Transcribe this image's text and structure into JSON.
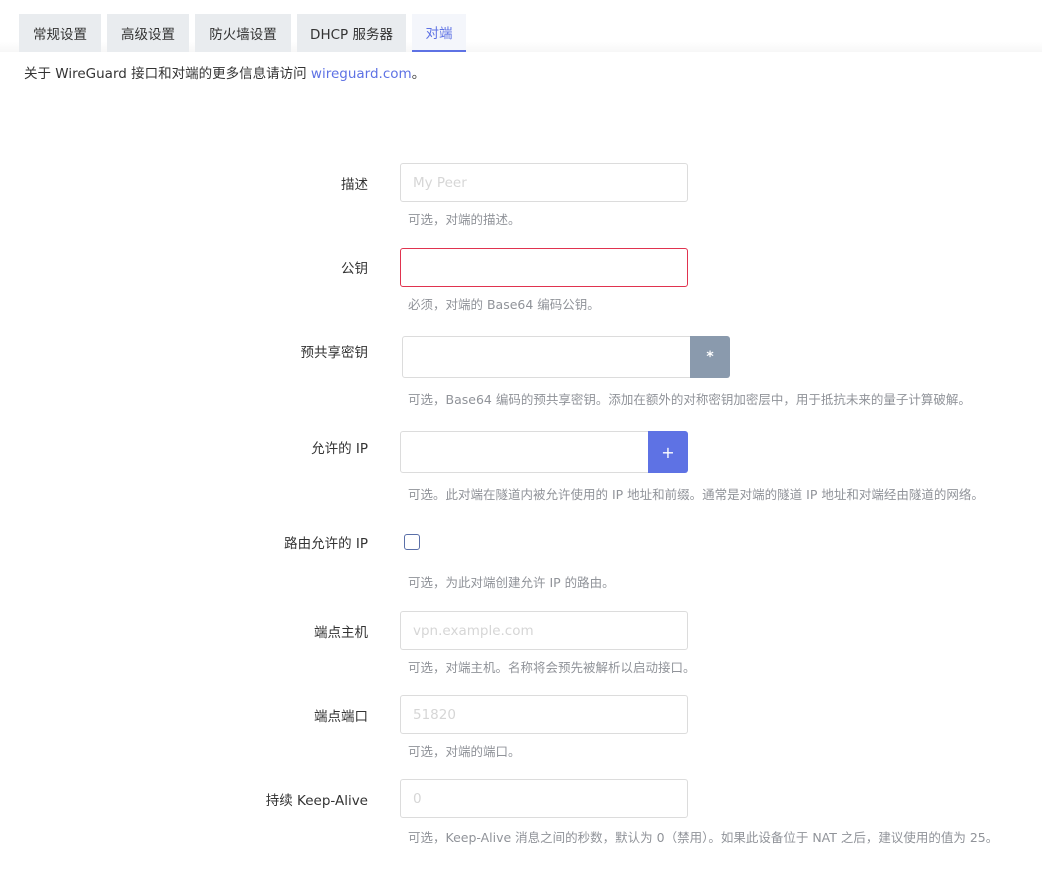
{
  "tabs": [
    {
      "label": "常规设置"
    },
    {
      "label": "高级设置"
    },
    {
      "label": "防火墙设置"
    },
    {
      "label": "DHCP 服务器"
    },
    {
      "label": "对端"
    }
  ],
  "info": {
    "prefix": "关于 WireGuard 接口和对端的更多信息请访问 ",
    "link_text": "wireguard.com",
    "suffix": "。"
  },
  "form": {
    "description": {
      "label": "描述",
      "placeholder": "My Peer",
      "value": "",
      "hint": "可选，对端的描述。"
    },
    "public_key": {
      "label": "公钥",
      "value": "",
      "hint": "必须，对端的 Base64 编码公钥。"
    },
    "preshared_key": {
      "label": "预共享密钥",
      "value": "",
      "button": "*",
      "hint": "可选，Base64 编码的预共享密钥。添加在额外的对称密钥加密层中，用于抵抗未来的量子计算破解。"
    },
    "allowed_ips": {
      "label": "允许的 IP",
      "value": "",
      "button": "+",
      "hint": "可选。此对端在隧道内被允许使用的 IP 地址和前缀。通常是对端的隧道 IP 地址和对端经由隧道的网络。"
    },
    "route_allowed_ips": {
      "label": "路由允许的 IP",
      "checked": false,
      "hint": "可选，为此对端创建允许 IP 的路由。"
    },
    "endpoint_host": {
      "label": "端点主机",
      "placeholder": "vpn.example.com",
      "value": "",
      "hint": "可选，对端主机。名称将会预先被解析以启动接口。"
    },
    "endpoint_port": {
      "label": "端点端口",
      "placeholder": "51820",
      "value": "",
      "hint": "可选，对端的端口。"
    },
    "keepalive": {
      "label": "持续 Keep-Alive",
      "placeholder": "0",
      "value": "",
      "hint": "可选，Keep-Alive 消息之间的秒数，默认为 0（禁用）。如果此设备位于 NAT 之后，建议使用的值为 25。"
    }
  },
  "colors": {
    "accent": "#5e72e4",
    "invalid": "#e0334f",
    "button_gray": "#8a9aad"
  }
}
